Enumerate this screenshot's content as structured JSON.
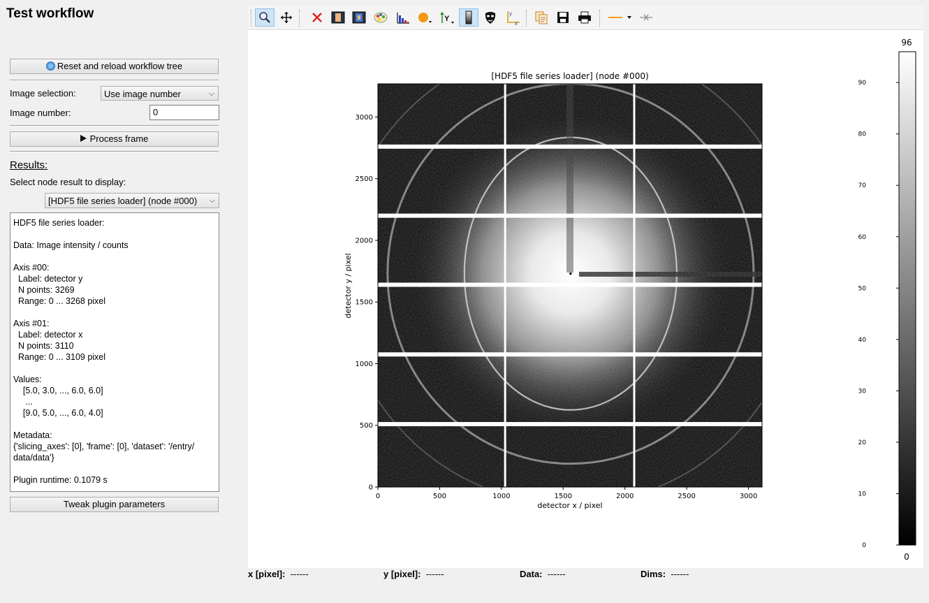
{
  "panel": {
    "title": "Test workflow",
    "reset_button": "Reset and reload workflow tree",
    "image_selection_label": "Image selection:",
    "image_selection_value": "Use image number",
    "image_number_label": "Image number:",
    "image_number_value": "0",
    "process_button": "Process frame",
    "results_label": "Results:",
    "select_node_label": "Select node result to display:",
    "node_select_value": "[HDF5 file series loader] (node #000)",
    "info_lines": [
      "HDF5 file series loader:",
      "",
      "Data: Image intensity / counts",
      "",
      "Axis #00:",
      "  Label: detector y",
      "  N points: 3269",
      "  Range: 0 ... 3268 pixel",
      "",
      "Axis #01:",
      "  Label: detector x",
      "  N points: 3110",
      "  Range: 0 ... 3109 pixel",
      "",
      "Values:",
      "    [5.0, 3.0, ..., 6.0, 6.0]",
      "     ...",
      "    [9.0, 5.0, ..., 6.0, 4.0]",
      "",
      "Metadata:",
      "{'slicing_axes': [0], 'frame': [0], 'dataset': '/entry/",
      "data/data'}",
      "",
      "Plugin runtime: 0.1079 s"
    ],
    "tweak_button": "Tweak plugin parameters"
  },
  "toolbar": {
    "items": [
      "zoom-icon",
      "pan-icon",
      "reset-zoom-icon",
      "crop-icon",
      "crop-center-icon",
      "colormap-icon",
      "histogram-icon",
      "marker-color-icon",
      "y-axis-icon",
      "colorbar-toggle-icon",
      "mask-icon",
      "axes-origin-icon",
      "copy-icon",
      "save-icon",
      "print-icon",
      "line-style-icon",
      "clear-icon"
    ],
    "colors": {
      "active_bg": "#cde4f7",
      "orange": "#f0a020"
    }
  },
  "chart_data": {
    "type": "heatmap",
    "title": "[HDF5 file series loader] (node #000)",
    "xlabel": "detector x / pixel",
    "ylabel": "detector y / pixel",
    "xlim": [
      0,
      3110
    ],
    "ylim": [
      0,
      3269
    ],
    "xticks": [
      "0",
      "500",
      "1000",
      "1500",
      "2000",
      "2500",
      "3000"
    ],
    "yticks": [
      "0",
      "500",
      "1000",
      "1500",
      "2000",
      "2500",
      "3000"
    ],
    "xtick_values": [
      0,
      500,
      1000,
      1500,
      2000,
      2500,
      3000
    ],
    "ytick_values": [
      0,
      500,
      1000,
      1500,
      2000,
      2500,
      3000
    ],
    "colormap": "gray",
    "colorbar": {
      "min_label": "0",
      "max_label": "96",
      "ticks": [
        "0",
        "10",
        "20",
        "30",
        "40",
        "50",
        "60",
        "70",
        "80",
        "90"
      ],
      "tick_values": [
        0,
        10,
        20,
        30,
        40,
        50,
        60,
        70,
        80,
        90
      ],
      "range": [
        0,
        96
      ]
    },
    "detector_gaps": {
      "vertical_x": [
        1030,
        2075
      ],
      "horizontal_y": [
        510,
        1075,
        1640,
        2200,
        2760
      ]
    },
    "beam_center": [
      1560,
      1730
    ]
  },
  "status": {
    "x_label": "x [pixel]:",
    "x_value": "------",
    "y_label": "y [pixel]:",
    "y_value": "------",
    "data_label": "Data:",
    "data_value": "------",
    "dims_label": "Dims:",
    "dims_value": "------"
  }
}
